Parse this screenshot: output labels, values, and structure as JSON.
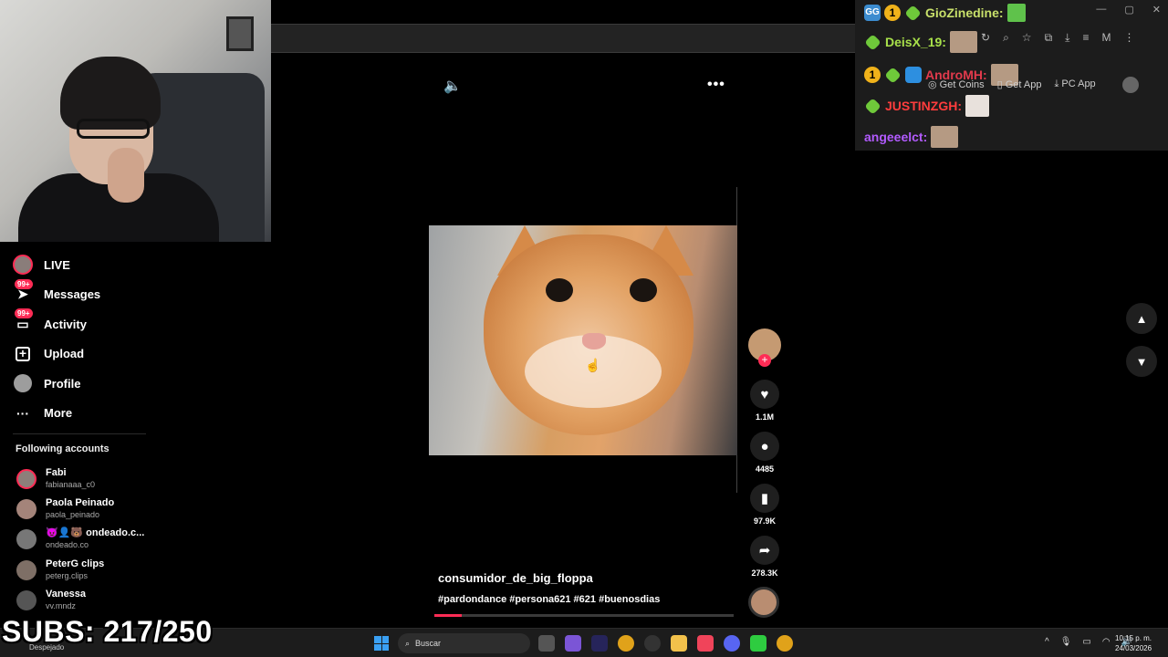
{
  "chat": {
    "messages": [
      {
        "user": "GioZinedine:"
      },
      {
        "user": "DeisX_19:"
      },
      {
        "user": "AndroMH:"
      },
      {
        "user": "JUSTINZGH:"
      },
      {
        "user": "angeeelct:"
      }
    ],
    "links": {
      "coins": "Get Coins",
      "app": "Get App",
      "pc": "PC App"
    }
  },
  "nav": {
    "items": [
      {
        "label": "LIVE"
      },
      {
        "label": "Messages",
        "badge": "99+"
      },
      {
        "label": "Activity",
        "badge": "99+"
      },
      {
        "label": "Upload"
      },
      {
        "label": "Profile"
      },
      {
        "label": "More"
      }
    ]
  },
  "following": {
    "title": "Following accounts",
    "accounts": [
      {
        "name": "Fabi",
        "handle": "fabianaaa_c0"
      },
      {
        "name": "Paola Peinado",
        "handle": "paola_peinado"
      },
      {
        "name": "😈👤🐻 ondeado.c...",
        "handle": "ondeado.co"
      },
      {
        "name": "PeterG clips",
        "handle": "peterg.clips"
      },
      {
        "name": "Vanessa",
        "handle": "vv.mndz"
      }
    ]
  },
  "video": {
    "username": "consumidor_de_big_floppa",
    "hashtags": "#pardondance #persona621 #621 #buenosdias",
    "progress_percent": 9
  },
  "actions": {
    "likes": "1.1M",
    "comments": "4485",
    "saves": "97.9K",
    "shares": "278.3K"
  },
  "overlay": {
    "subs": "SUBS: 217/250"
  },
  "taskbar": {
    "weather": "Despejado",
    "search_placeholder": "Buscar",
    "time": "10:15 p. m.",
    "date": "24/03/2026"
  },
  "colors": {
    "accent": "#fe2c55",
    "background": "#000000"
  }
}
